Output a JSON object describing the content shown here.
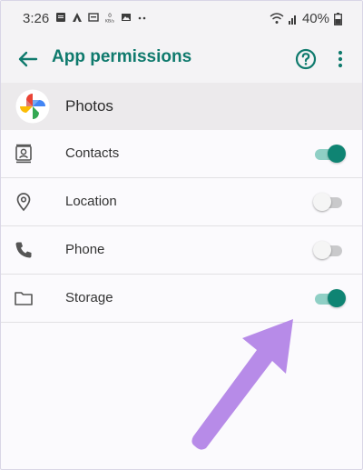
{
  "status_bar": {
    "time": "3:26",
    "battery": "40%",
    "icons": [
      "notification-icon",
      "app-icon",
      "cast-icon",
      "data-speed-icon",
      "image-icon",
      "more-notifications-icon",
      "wifi-icon",
      "signal-icon",
      "battery-icon"
    ]
  },
  "app_bar": {
    "title": "App permissions",
    "back_icon": "arrow-back-icon",
    "help_icon": "help-icon",
    "more_icon": "more-vert-icon"
  },
  "app": {
    "name": "Photos",
    "icon": "google-photos-icon"
  },
  "permissions": [
    {
      "label": "Contacts",
      "icon": "contacts-icon",
      "enabled": true
    },
    {
      "label": "Location",
      "icon": "location-icon",
      "enabled": false
    },
    {
      "label": "Phone",
      "icon": "phone-icon",
      "enabled": false
    },
    {
      "label": "Storage",
      "icon": "folder-icon",
      "enabled": true
    }
  ],
  "annotation": {
    "type": "arrow",
    "color": "#b78be8",
    "points_to": "Storage toggle"
  },
  "colors": {
    "accent": "#0f7a6d",
    "toggle_on_thumb": "#0f8473",
    "toggle_on_track": "#8fcfc5",
    "toggle_off_track": "#c9c9cb"
  }
}
